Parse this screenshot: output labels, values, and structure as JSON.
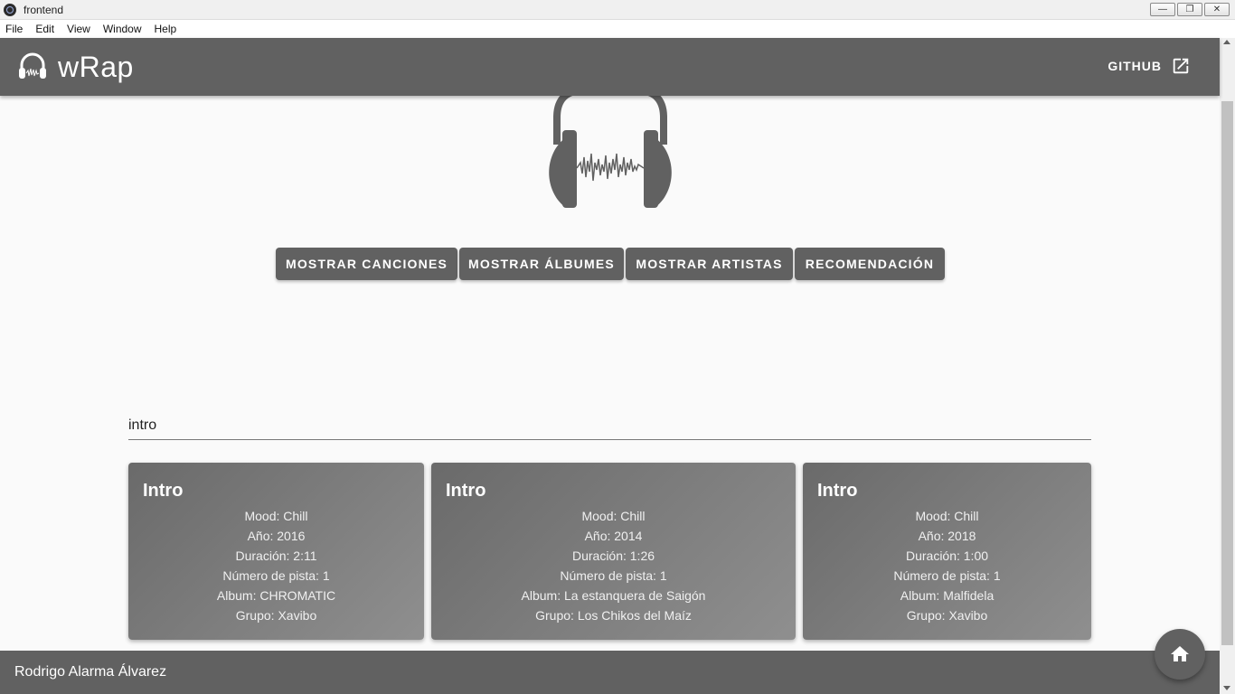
{
  "window": {
    "title": "frontend",
    "controls": [
      "minimize",
      "restore",
      "close"
    ]
  },
  "menu": [
    "File",
    "Edit",
    "View",
    "Window",
    "Help"
  ],
  "appbar": {
    "brand": "wRap",
    "github_label": "GITHUB",
    "logo_icon": "headphones-icon",
    "github_icon": "open-in-new-icon"
  },
  "actions": [
    "MOSTRAR CANCIONES",
    "MOSTRAR ÁLBUMES",
    "MOSTRAR ARTISTAS",
    "RECOMENDACIÓN"
  ],
  "search": {
    "value": "intro"
  },
  "results": [
    {
      "title": "Intro",
      "mood": "Mood: Chill",
      "year": "Año: 2016",
      "duration": "Duración: 2:11",
      "track": "Número de pista: 1",
      "album": "Album: CHROMATIC",
      "group": "Grupo: Xavibo"
    },
    {
      "title": "Intro",
      "mood": "Mood: Chill",
      "year": "Año: 2014",
      "duration": "Duración: 1:26",
      "track": "Número de pista: 1",
      "album": "Album: La estanquera de Saigón",
      "group": "Grupo: Los Chikos del Maíz"
    },
    {
      "title": "Intro",
      "mood": "Mood: Chill",
      "year": "Año: 2018",
      "duration": "Duración: 1:00",
      "track": "Número de pista: 1",
      "album": "Album: Malfidela",
      "group": "Grupo: Xavibo"
    }
  ],
  "footer": {
    "author": "Rodrigo Alarma Álvarez"
  },
  "fab": {
    "icon": "home-icon"
  },
  "colors": {
    "primary": "#616161",
    "background": "#fafafa",
    "text_on_primary": "#ffffff"
  }
}
